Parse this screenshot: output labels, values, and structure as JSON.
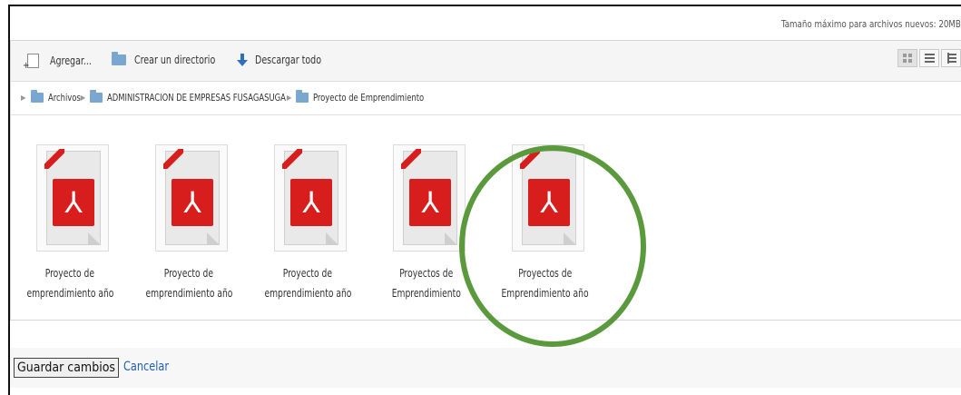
{
  "header": {
    "max_size_text": "Tamaño máximo para archivos nuevos: 20MB"
  },
  "toolbar": {
    "add_label": "Agregar...",
    "create_dir_label": "Crear un directorio",
    "download_all_label": "Descargar todo",
    "view_modes": [
      "icons-view",
      "list-view",
      "tree-view"
    ]
  },
  "breadcrumb": [
    "Archivos",
    "ADMINISTRACION DE EMPRESAS FUSAGASUGA",
    "Proyecto de Emprendimiento"
  ],
  "files": [
    {
      "line1": "Proyecto de",
      "line2": "emprendimiento año",
      "icon": "pdf-file-icon"
    },
    {
      "line1": "Proyecto de",
      "line2": "emprendimiento año",
      "icon": "pdf-file-icon"
    },
    {
      "line1": "Proyecto de",
      "line2": "emprendimiento año",
      "icon": "pdf-file-icon"
    },
    {
      "line1": "Proyectos de",
      "line2": "Emprendimiento",
      "icon": "pdf-file-icon"
    },
    {
      "line1": "Proyectos de",
      "line2": "Emprendimiento año",
      "icon": "pdf-file-icon"
    }
  ],
  "footer": {
    "save_label": "Guardar cambios",
    "cancel_label": "Cancelar"
  },
  "colors": {
    "highlight_circle": "#5a9a3d",
    "pdf_red": "#d81d1d",
    "link_blue": "#1f5fb4"
  }
}
